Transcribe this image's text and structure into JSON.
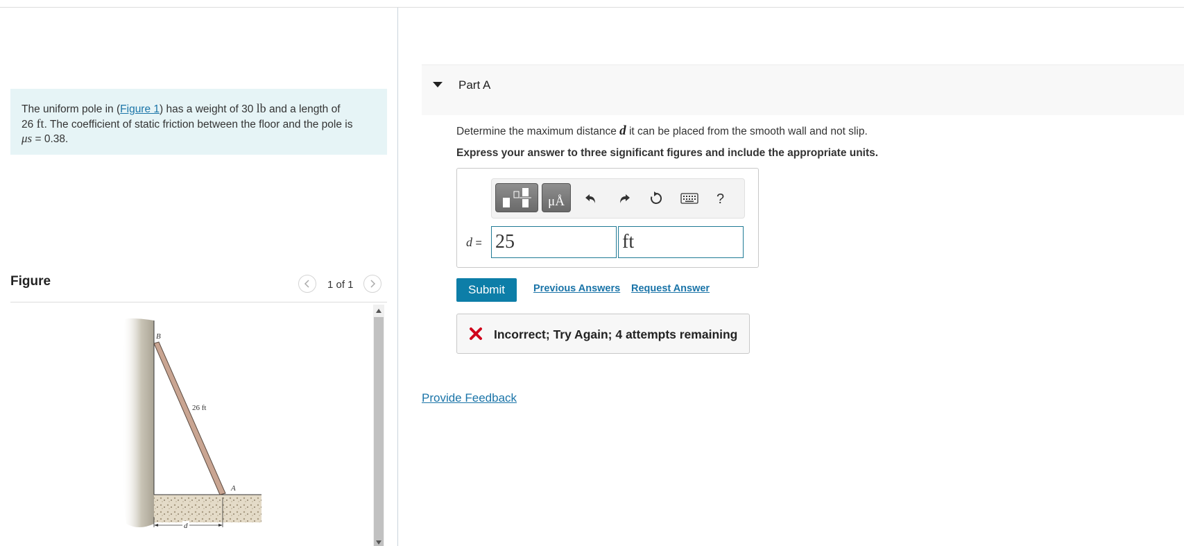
{
  "problem": {
    "text_1": "The uniform pole in (",
    "figure_link": "Figure 1",
    "text_2": ") has a weight of 30 ",
    "unit_lb": "lb",
    "text_3": " and a length of",
    "text_4": "26 ",
    "unit_ft": "ft",
    "text_5": ". The coefficient of static friction between the floor and the pole is",
    "mu_symbol": "μs",
    "mu_value": " = 0.38."
  },
  "figure_panel": {
    "title": "Figure",
    "count": "1 of 1",
    "labels": {
      "top": "B",
      "bottom": "A",
      "length": "26 ft",
      "distance": "d"
    }
  },
  "part": {
    "title": "Part A",
    "question_1": "Determine the maximum distance ",
    "question_var": "d",
    "question_2": " it can be placed from the smooth wall and not slip.",
    "instruction": "Express your answer to three significant figures and include the appropriate units."
  },
  "toolbar": {
    "units_label": "μÅ",
    "help": "?"
  },
  "answer": {
    "var": "d",
    "eq": " =",
    "value": "25",
    "units": "ft"
  },
  "actions": {
    "submit": "Submit",
    "previous_answers": "Previous Answers",
    "request_answer": "Request Answer"
  },
  "feedback": {
    "message": "Incorrect; Try Again; 4 attempts remaining"
  },
  "footer": {
    "provide_feedback": "Provide Feedback"
  }
}
